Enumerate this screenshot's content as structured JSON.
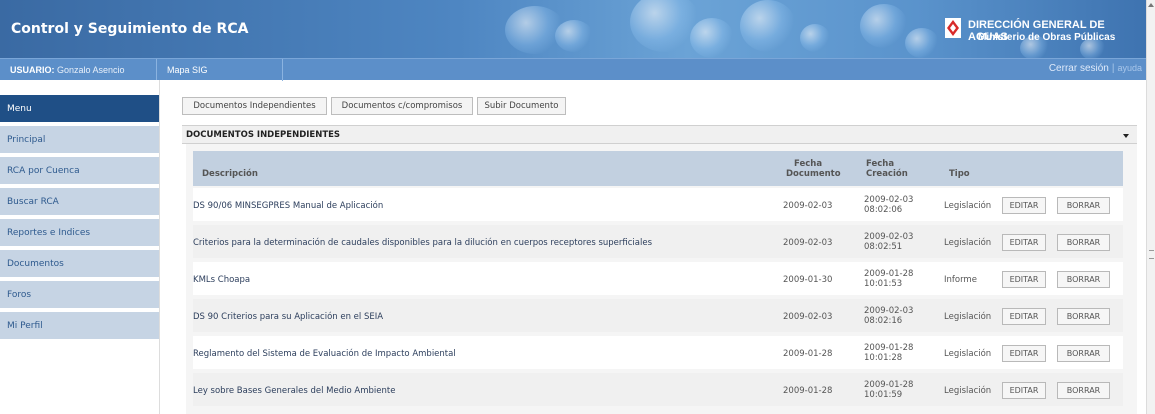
{
  "header": {
    "app_title": "Control y Seguimiento de RCA",
    "org_title": "DIRECCIÓN GENERAL DE AGUAS",
    "org_subtitle": "Ministerio de Obras Públicas"
  },
  "topbar": {
    "user_label": "USUARIO:",
    "user_name": "Gonzalo Asencio",
    "mapa_link": "Mapa SIG",
    "logout": "Cerrar sesión",
    "separator": "|",
    "help": "ayuda"
  },
  "sidebar": {
    "items": [
      {
        "label": "Menu"
      },
      {
        "label": "Principal"
      },
      {
        "label": "RCA por Cuenca"
      },
      {
        "label": "Buscar RCA"
      },
      {
        "label": "Reportes e Indices"
      },
      {
        "label": "Documentos"
      },
      {
        "label": "Foros"
      },
      {
        "label": "Mi Perfil"
      }
    ]
  },
  "tabs": [
    {
      "label": "Documentos Independientes"
    },
    {
      "label": "Documentos c/compromisos"
    },
    {
      "label": "Subir Documento"
    }
  ],
  "section": {
    "title": "DOCUMENTOS INDEPENDIENTES",
    "arrow_icon": "dropdown-arrow-icon"
  },
  "table": {
    "headers": {
      "descripcion": "Descripción",
      "fecha_doc_1": "Fecha",
      "fecha_doc_2": "Documento",
      "fecha_cre_1": "Fecha",
      "fecha_cre_2": "Creación",
      "tipo": "Tipo"
    },
    "rows": [
      {
        "desc": "DS 90/06 MINSEGPRES Manual de Aplicación",
        "fecha_doc": "2009-02-03",
        "fecha_cre_date": "2009-02-03",
        "fecha_cre_time": "08:02:06",
        "tipo": "Legislación",
        "edit": "EDITAR",
        "delete": "BORRAR"
      },
      {
        "desc": "Criterios para la determinación de caudales disponibles para la dilución en cuerpos receptores superficiales",
        "fecha_doc": "2009-02-03",
        "fecha_cre_date": "2009-02-03",
        "fecha_cre_time": "08:02:51",
        "tipo": "Legislación",
        "edit": "EDITAR",
        "delete": "BORRAR"
      },
      {
        "desc": "KMLs Choapa",
        "fecha_doc": "2009-01-30",
        "fecha_cre_date": "2009-01-28",
        "fecha_cre_time": "10:01:53",
        "tipo": "Informe",
        "edit": "EDITAR",
        "delete": "BORRAR"
      },
      {
        "desc": "DS 90 Criterios para su Aplicación en el SEIA",
        "fecha_doc": "2009-02-03",
        "fecha_cre_date": "2009-02-03",
        "fecha_cre_time": "08:02:16",
        "tipo": "Legislación",
        "edit": "EDITAR",
        "delete": "BORRAR"
      },
      {
        "desc": "Reglamento del Sistema de Evaluación de Impacto Ambiental",
        "fecha_doc": "2009-01-28",
        "fecha_cre_date": "2009-01-28",
        "fecha_cre_time": "10:01:28",
        "tipo": "Legislación",
        "edit": "EDITAR",
        "delete": "BORRAR"
      },
      {
        "desc": "Ley sobre Bases Generales del Medio Ambiente",
        "fecha_doc": "2009-01-28",
        "fecha_cre_date": "2009-01-28",
        "fecha_cre_time": "10:01:59",
        "tipo": "Legislación",
        "edit": "EDITAR",
        "delete": "BORRAR"
      }
    ]
  },
  "colors": {
    "header_blue": "#4e86c2",
    "topbar_blue": "#5c8fc9",
    "menu_active": "#1f4f86",
    "sidebar_item": "#c6d4e4",
    "table_header": "#c2d0e0"
  }
}
